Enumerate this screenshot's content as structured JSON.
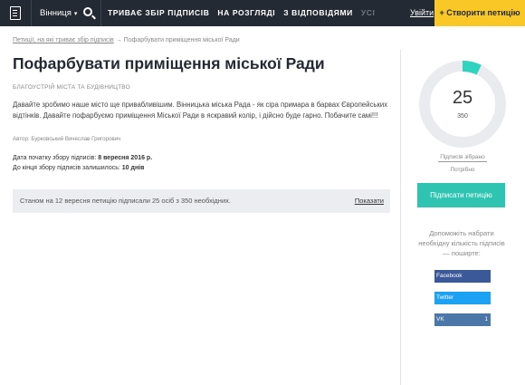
{
  "header": {
    "city": "Вінниця",
    "tabs": [
      {
        "label": "ТРИВАЄ ЗБІР ПІДПИСІВ"
      },
      {
        "label": "НА РОЗГЛЯДІ"
      },
      {
        "label": "З ВІДПОВІДЯМИ"
      },
      {
        "label": "УСІ"
      }
    ],
    "login": "Увійти",
    "create": "+ Створити петицію"
  },
  "breadcrumb": {
    "link": "Петиції, на які триває збір підписів",
    "arrow": "→",
    "current": "Пофарбувати приміщення міської Ради"
  },
  "petition": {
    "title": "Пофарбувати приміщення міської Ради",
    "category": "БЛАГОУСТРІЙ МІСТА ТА БУДІВНИЦТВО",
    "description": "Давайте зробимо наше місто ще привабливішим. Вінницька міська Рада - як сіра примара в барвах Європейських відтінків. Давайте пофарбуємо приміщення Міської Ради в яскравий колір, і дійсно буде гарно. Побачите самі!!!",
    "author": "Автор: Бурковський Вячеслав Григорович",
    "start_label": "Дата початку збору підписів:",
    "start_value": "8 вересня 2016 р.",
    "remain_label": "До кінця збору підписів залишилось:",
    "remain_value": "10 днів"
  },
  "status": {
    "text": "Станом на 12 вересня петицію підписали 25 осіб з 350 необхідних.",
    "show": "Показати"
  },
  "progress": {
    "count": "25",
    "goal": "350",
    "fraction": 0.0714,
    "collected_label": "Підписів зібрано",
    "needed_label": "Потрібно",
    "fill_color": "#2fd3be",
    "track_color": "#e9ebee"
  },
  "sidebar": {
    "sign": "Підписати петицію",
    "help": "Допоможіть набрати необхідну кількість підписів — поширте:",
    "share": {
      "facebook": "Facebook",
      "twitter": "Twitter",
      "vk": "VK",
      "vk_count": "1"
    }
  }
}
